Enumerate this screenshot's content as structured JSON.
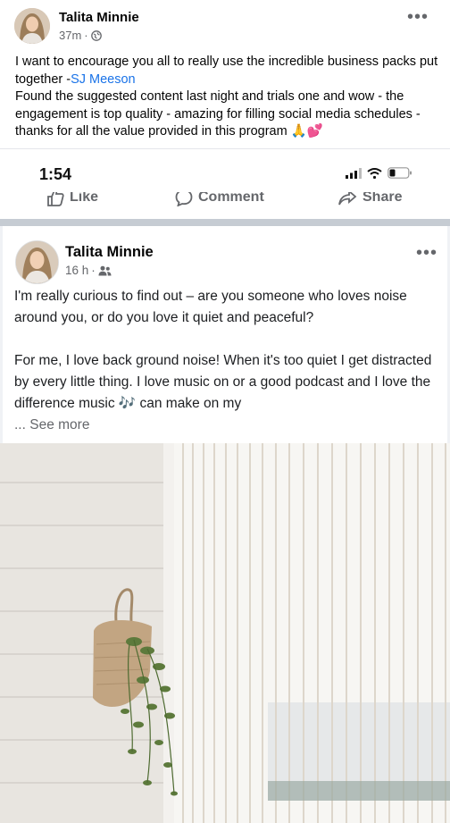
{
  "post1": {
    "author": "Talita Minnie",
    "time": "37m",
    "sep": "·",
    "privacy_icon": "globe-icon",
    "menu": "•••",
    "text_a": "I want to encourage you all to really use the incredible business packs put together -",
    "mention": "SJ Meeson",
    "text_b": "Found the suggested content last night and trials one and wow - the engagement is top quality - amazing for filling social media schedules - thanks for all the value provided in this program 🙏💕"
  },
  "screenshot": {
    "time": "1:54",
    "actions": {
      "like": "Like",
      "comment": "Comment",
      "share": "Share"
    },
    "post": {
      "author": "Talita Minnie",
      "time": "16 h",
      "sep": "·",
      "privacy_icon": "group-icon",
      "menu": "•••",
      "paragraph1": "I'm really curious to find out – are you someone who loves noise around you, or do you love it quiet and peaceful?",
      "paragraph2": "For me, I love back ground noise!  When it's too quiet I get distracted by every little thing.  I love music on or a good podcast and I love the difference music 🎶 can make on my",
      "see_more_prefix": "... ",
      "see_more": "See more"
    }
  }
}
